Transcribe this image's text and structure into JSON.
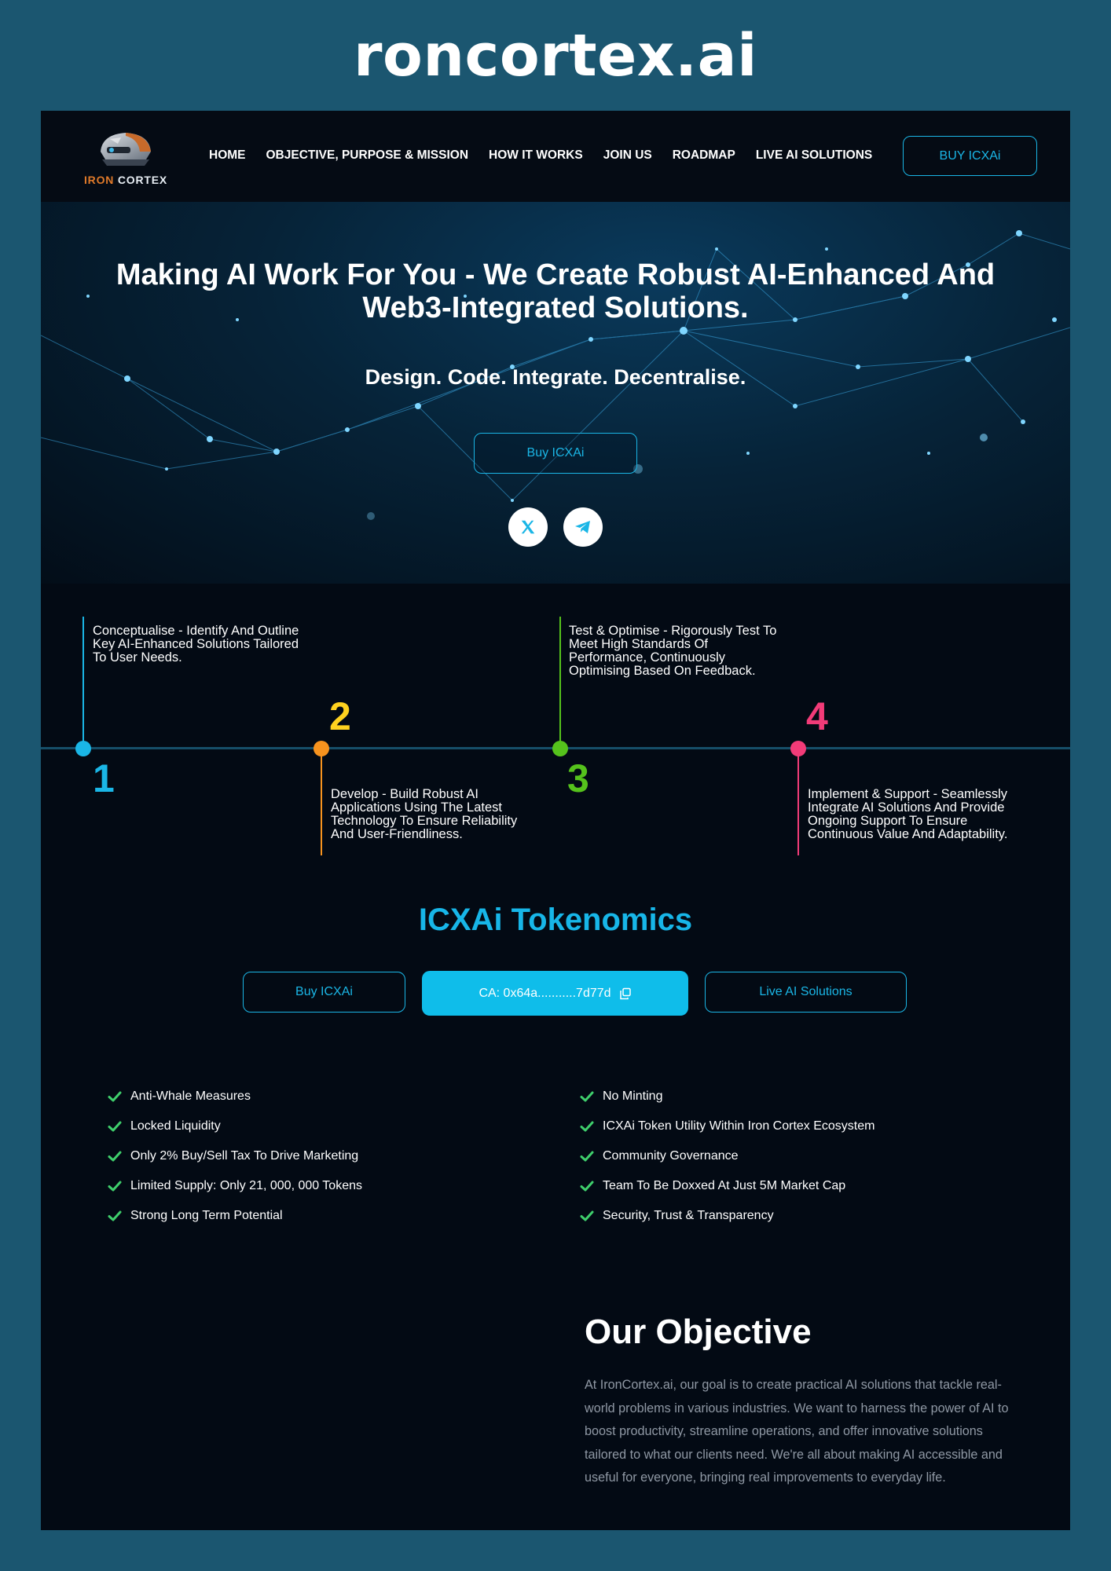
{
  "site_title": "roncortex.ai",
  "colors": {
    "page_bg": "#1b5670",
    "frame_bg": "#030a14",
    "accent": "#1ab6e6",
    "step1": "#1ab6e6",
    "step2": "#f7931e",
    "step3": "#55c21c",
    "step4": "#f23b78",
    "num2": "#ffd21f",
    "check": "#3fcf6c"
  },
  "nav": {
    "logo": {
      "iron": "IRON",
      "cortex": "CORTEX"
    },
    "items": [
      "HOME",
      "OBJECTIVE, PURPOSE & MISSION",
      "HOW IT WORKS",
      "JOIN US",
      "ROADMAP",
      "LIVE AI SOLUTIONS"
    ],
    "buy_label": "BUY ICXAi"
  },
  "hero": {
    "title": "Making AI Work For You - We Create Robust AI-Enhanced And Web3-Integrated Solutions.",
    "subtitle": "Design. Code. Integrate. Decentralise.",
    "buy_label": "Buy ICXAi",
    "social_icons": [
      "x-icon",
      "telegram-icon"
    ]
  },
  "timeline": [
    {
      "number": "1",
      "text": "Conceptualise - Identify And Outline Key AI-Enhanced Solutions Tailored To User Needs."
    },
    {
      "number": "2",
      "text": "Develop - Build Robust AI Applications Using The Latest Technology To Ensure Reliability And User-Friendliness."
    },
    {
      "number": "3",
      "text": "Test & Optimise - Rigorously Test To Meet High Standards Of Performance, Continuously Optimising Based On Feedback."
    },
    {
      "number": "4",
      "text": "Implement & Support - Seamlessly Integrate AI Solutions And Provide Ongoing Support To Ensure Continuous Value And Adaptability."
    }
  ],
  "tokenomics": {
    "title": "ICXAi Tokenomics",
    "buy_label": "Buy ICXAi",
    "ca_label": "CA: 0x64a...........7d77d",
    "live_label": "Live AI Solutions",
    "features_left": [
      "Anti-Whale Measures",
      "Locked Liquidity",
      "Only 2% Buy/Sell Tax To Drive Marketing",
      "Limited Supply: Only 21, 000, 000 Tokens",
      "Strong Long Term Potential"
    ],
    "features_right": [
      "No Minting",
      "ICXAi Token Utility Within Iron Cortex Ecosystem",
      "Community Governance",
      "Team To Be Doxxed At Just 5M Market Cap",
      "Security, Trust & Transparency"
    ]
  },
  "objective": {
    "title": "Our Objective",
    "body": "At IronCortex.ai, our goal is to create practical AI solutions that tackle real-world problems in various industries. We want to harness the power of AI to boost productivity, streamline operations, and offer innovative solutions tailored to what our clients need. We're all about making AI accessible and useful for everyone, bringing real improvements to everyday life."
  }
}
